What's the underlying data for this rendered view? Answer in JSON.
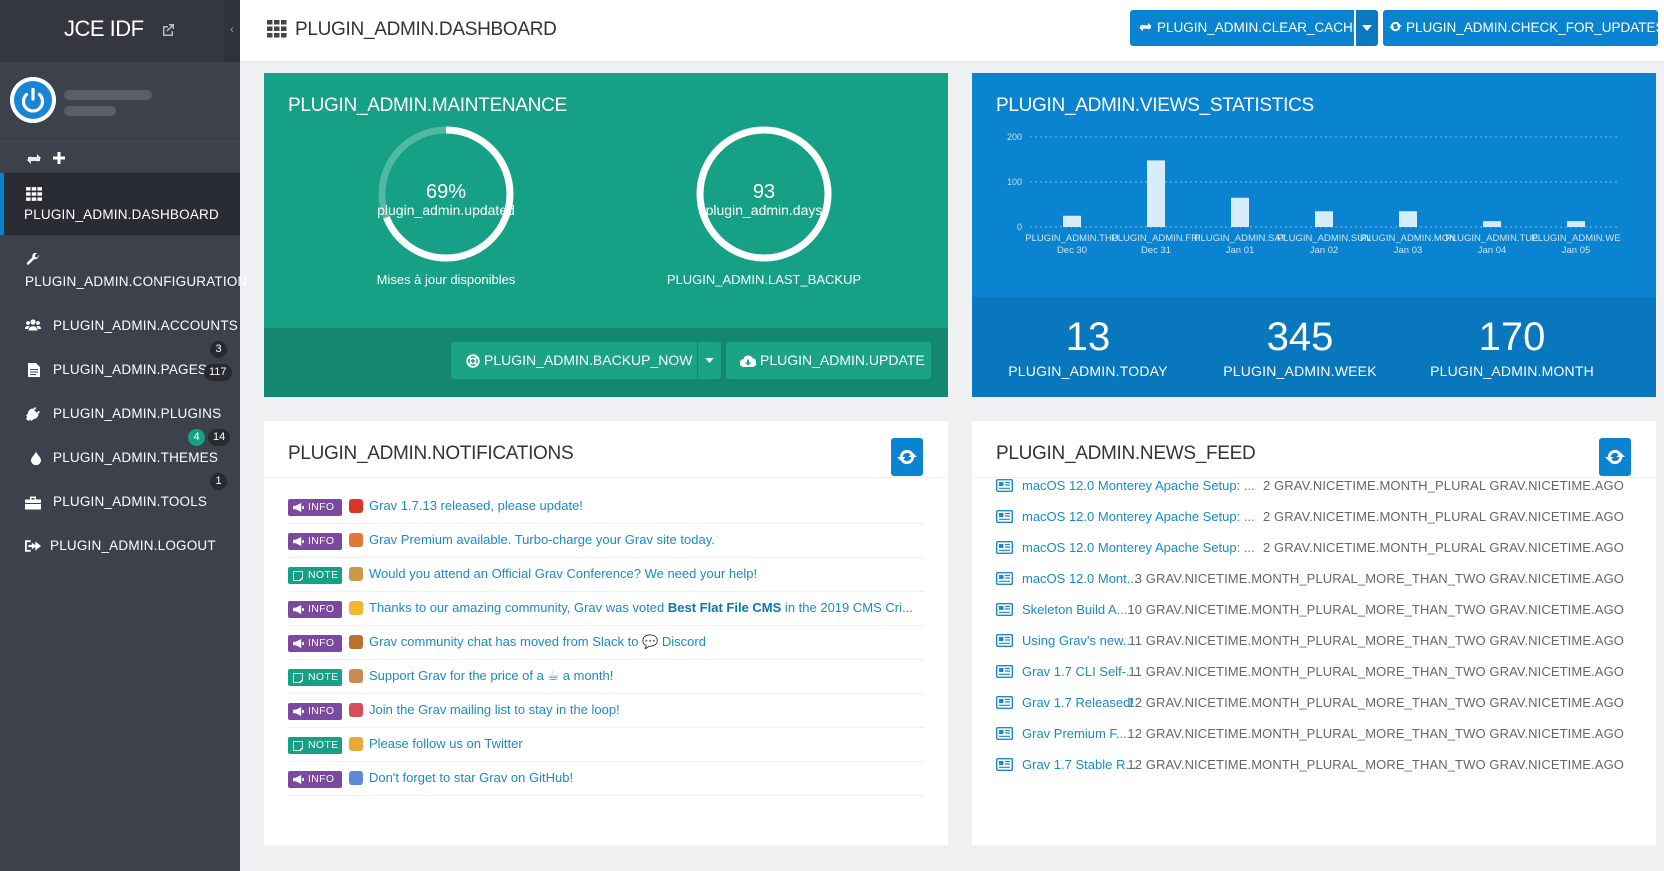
{
  "sidebar": {
    "site_name": "JCE IDF",
    "collapse_glyph": "‹",
    "items": [
      {
        "label": "PLUGIN_ADMIN.DASHBOARD",
        "icon": "dashboard-icon"
      },
      {
        "label": "PLUGIN_ADMIN.CONFIGURATION",
        "icon": "wrench-icon"
      },
      {
        "label": "PLUGIN_ADMIN.ACCOUNTS",
        "icon": "users-icon",
        "badge": "3"
      },
      {
        "label": "PLUGIN_ADMIN.PAGES",
        "icon": "file-icon",
        "badge": "117"
      },
      {
        "label": "PLUGIN_ADMIN.PLUGINS",
        "icon": "plug-icon",
        "badge_update": "4",
        "badge": "14"
      },
      {
        "label": "PLUGIN_ADMIN.THEMES",
        "icon": "tint-icon",
        "badge": "1"
      },
      {
        "label": "PLUGIN_ADMIN.TOOLS",
        "icon": "briefcase-icon"
      },
      {
        "label": "PLUGIN_ADMIN.LOGOUT",
        "icon": "sign-out-icon"
      }
    ]
  },
  "header": {
    "title": "PLUGIN_ADMIN.DASHBOARD",
    "clear_cache": "PLUGIN_ADMIN.CLEAR_CACHE",
    "check_updates": "PLUGIN_ADMIN.CHECK_FOR_UPDATES"
  },
  "maintenance": {
    "title": "PLUGIN_ADMIN.MAINTENANCE",
    "updates_percent": "69%",
    "updates_fraction": 0.69,
    "updates_sub": "plugin_admin.updated",
    "updates_caption": "Mises à jour disponibles",
    "backup_days": "93",
    "backup_fraction": 1.0,
    "backup_sub": "plugin_admin.days",
    "backup_caption": "PLUGIN_ADMIN.LAST_BACKUP",
    "backup_now": "PLUGIN_ADMIN.BACKUP_NOW",
    "update": "PLUGIN_ADMIN.UPDATE"
  },
  "stats": {
    "title": "PLUGIN_ADMIN.VIEWS_STATISTICS",
    "today_value": "13",
    "today_label": "PLUGIN_ADMIN.TODAY",
    "week_value": "345",
    "week_label": "PLUGIN_ADMIN.WEEK",
    "month_value": "170",
    "month_label": "PLUGIN_ADMIN.MONTH"
  },
  "chart_data": {
    "type": "bar",
    "categories": [
      [
        "PLUGIN_ADMIN.THU",
        "Dec 30"
      ],
      [
        "PLUGIN_ADMIN.FRI",
        "Dec 31"
      ],
      [
        "PLUGIN_ADMIN.SAT",
        "Jan 01"
      ],
      [
        "PLUGIN_ADMIN.SUN",
        "Jan 02"
      ],
      [
        "PLUGIN_ADMIN.MON",
        "Jan 03"
      ],
      [
        "PLUGIN_ADMIN.TUE",
        "Jan 04"
      ],
      [
        "PLUGIN_ADMIN.WE",
        "Jan 05"
      ]
    ],
    "values": [
      25,
      148,
      65,
      35,
      35,
      13,
      13
    ],
    "yticks": [
      0,
      100,
      200
    ],
    "ylim": [
      0,
      200
    ],
    "grid": true,
    "bar_color": "#d6ecf8"
  },
  "notifications": {
    "title": "PLUGIN_ADMIN.NOTIFICATIONS",
    "items": [
      {
        "type": "INFO",
        "emoji_color": "#d9342b",
        "text": "Grav 1.7.13 released, please update!"
      },
      {
        "type": "INFO",
        "emoji_color": "#e0783a",
        "text": "Grav Premium available. Turbo-charge your Grav site today."
      },
      {
        "type": "NOTE",
        "emoji_color": "#c89a4a",
        "text": "Would you attend an Official Grav Conference? We need your help!"
      },
      {
        "type": "INFO",
        "emoji_color": "#f2b630",
        "text_before": "Thanks to our amazing community, Grav was voted ",
        "text_bold": "Best Flat File CMS",
        "text_after": " in the 2019 CMS Cri..."
      },
      {
        "type": "INFO",
        "emoji_color": "#b8742e",
        "text": "Grav community chat has moved from Slack to 💬 Discord"
      },
      {
        "type": "NOTE",
        "emoji_color": "#c98a54",
        "text": "Support Grav for the price of a ☕ a month!"
      },
      {
        "type": "INFO",
        "emoji_color": "#d44f5a",
        "text": "Join the Grav mailing list to stay in the loop!"
      },
      {
        "type": "NOTE",
        "emoji_color": "#e8a83a",
        "text": "Please follow us on Twitter"
      },
      {
        "type": "INFO",
        "emoji_color": "#5a8ad8",
        "text": "Don't forget to star Grav on GitHub!"
      }
    ]
  },
  "news": {
    "title": "PLUGIN_ADMIN.NEWS_FEED",
    "items": [
      {
        "title": "macOS 12.0 Monterey Apache Setup: ...",
        "time": "2 GRAV.NICETIME.MONTH_PLURAL GRAV.NICETIME.AGO"
      },
      {
        "title": "macOS 12.0 Monterey Apache Setup: ...",
        "time": "2 GRAV.NICETIME.MONTH_PLURAL GRAV.NICETIME.AGO"
      },
      {
        "title": "macOS 12.0 Monterey Apache Setup: ...",
        "time": "2 GRAV.NICETIME.MONTH_PLURAL GRAV.NICETIME.AGO"
      },
      {
        "title": "macOS 12.0 Mont...",
        "time": "3 GRAV.NICETIME.MONTH_PLURAL_MORE_THAN_TWO GRAV.NICETIME.AGO"
      },
      {
        "title": "Skeleton Build A...",
        "time": "10 GRAV.NICETIME.MONTH_PLURAL_MORE_THAN_TWO GRAV.NICETIME.AGO"
      },
      {
        "title": "Using Grav's new...",
        "time": "11 GRAV.NICETIME.MONTH_PLURAL_MORE_THAN_TWO GRAV.NICETIME.AGO"
      },
      {
        "title": "Grav 1.7 CLI Self-...",
        "time": "11 GRAV.NICETIME.MONTH_PLURAL_MORE_THAN_TWO GRAV.NICETIME.AGO"
      },
      {
        "title": "Grav 1.7 Released!",
        "time": "12 GRAV.NICETIME.MONTH_PLURAL_MORE_THAN_TWO GRAV.NICETIME.AGO"
      },
      {
        "title": "Grav Premium F...",
        "time": "12 GRAV.NICETIME.MONTH_PLURAL_MORE_THAN_TWO GRAV.NICETIME.AGO"
      },
      {
        "title": "Grav 1.7 Stable R...",
        "time": "12 GRAV.NICETIME.MONTH_PLURAL_MORE_THAN_TWO GRAV.NICETIME.AGO"
      }
    ]
  },
  "colors": {
    "sidebar_bg": "#3d414c",
    "accent_blue": "#0a84d1",
    "accent_green": "#16a085",
    "info_tag": "#7b4aa0"
  }
}
